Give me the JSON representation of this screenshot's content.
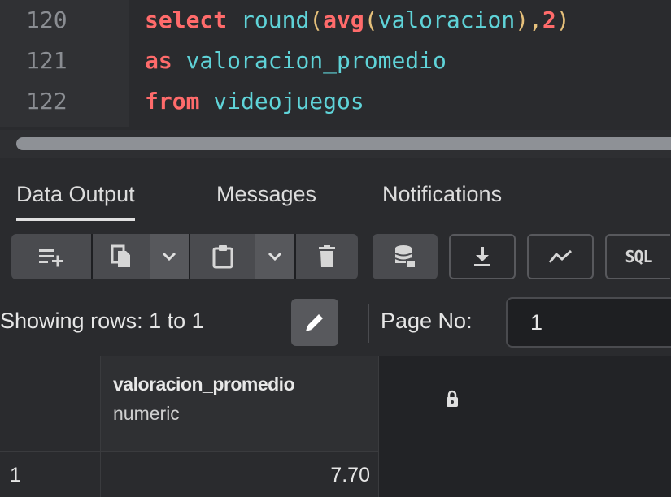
{
  "editor": {
    "lines": [
      {
        "number": "120",
        "tokens": [
          [
            "kw",
            "select"
          ],
          [
            "pl",
            " "
          ],
          [
            "fn",
            "round"
          ],
          [
            "pl",
            "("
          ],
          [
            "kw",
            "avg"
          ],
          [
            "pl",
            "("
          ],
          [
            "fn",
            "valoracion"
          ],
          [
            "pl",
            "),"
          ],
          [
            "kw",
            "2"
          ],
          [
            "pl",
            ")"
          ]
        ]
      },
      {
        "number": "121",
        "tokens": [
          [
            "kw",
            "as"
          ],
          [
            "pl",
            " "
          ],
          [
            "fn",
            "valoracion_promedio"
          ]
        ]
      },
      {
        "number": "122",
        "tokens": [
          [
            "kw",
            "from"
          ],
          [
            "pl",
            " "
          ],
          [
            "fn",
            "videojuegos"
          ]
        ]
      }
    ]
  },
  "tabs": [
    {
      "label": "Data Output",
      "active": true
    },
    {
      "label": "Messages",
      "active": false
    },
    {
      "label": "Notifications",
      "active": false
    }
  ],
  "toolbar": {
    "buttons": [
      {
        "icon": "add-row-icon"
      },
      {
        "icon": "copy-icon"
      },
      {
        "icon": "chevron-down-icon"
      },
      {
        "icon": "paste-icon"
      },
      {
        "icon": "chevron-down-icon"
      },
      {
        "icon": "delete-icon"
      },
      {
        "icon": "save-data-icon"
      },
      {
        "icon": "download-icon"
      },
      {
        "icon": "graph-icon"
      },
      {
        "icon": "sql-icon",
        "label": "SQL"
      }
    ]
  },
  "pager": {
    "showing_label": "Showing rows: 1 to 1",
    "page_label": "Page No:",
    "page_value": "1"
  },
  "grid": {
    "columns": [
      {
        "name": "valoracion_promedio",
        "type": "numeric",
        "locked": true
      }
    ],
    "rows": [
      {
        "index": "1",
        "cells": [
          "7.70"
        ]
      }
    ]
  },
  "colors": {
    "keyword": "#ff6b6b",
    "identifier": "#5fd3d8",
    "punctuation": "#e5c07b",
    "background": "#2a2b2e"
  }
}
